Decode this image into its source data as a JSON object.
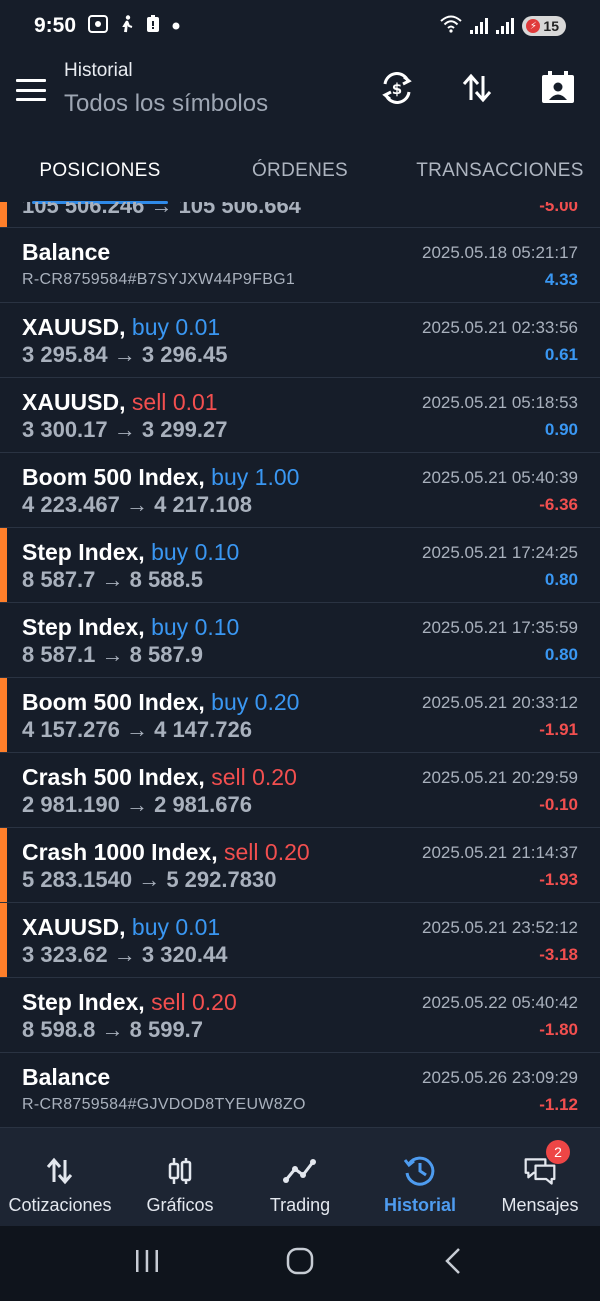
{
  "status_bar": {
    "time": "9:50",
    "battery": "15"
  },
  "header": {
    "title": "Historial",
    "subtitle": "Todos los símbolos"
  },
  "tabs": [
    {
      "label": "POSICIONES",
      "active": true
    },
    {
      "label": "ÓRDENES",
      "active": false
    },
    {
      "label": "TRANSACCIONES",
      "active": false
    }
  ],
  "partial_row": {
    "prices": "105 506.246 → 105 506.664",
    "profit": "-5.00"
  },
  "rows": [
    {
      "symbol": "Balance",
      "side": "",
      "volume": "",
      "sub": "R-CR8759584#B7SYJXW44P9FBG1",
      "time": "2025.05.18 05:21:17",
      "profit": "4.33",
      "positive": true,
      "marker": false,
      "kind": "balance"
    },
    {
      "symbol": "XAUUSD,",
      "side": "buy",
      "volume": "0.01",
      "sub": "3 295.84 → 3 296.45",
      "time": "2025.05.21 02:33:56",
      "profit": "0.61",
      "positive": true,
      "marker": false,
      "kind": "trade"
    },
    {
      "symbol": "XAUUSD,",
      "side": "sell",
      "volume": "0.01",
      "sub": "3 300.17 → 3 299.27",
      "time": "2025.05.21 05:18:53",
      "profit": "0.90",
      "positive": true,
      "marker": false,
      "kind": "trade"
    },
    {
      "symbol": "Boom 500 Index,",
      "side": "buy",
      "volume": "1.00",
      "sub": "4 223.467 → 4 217.108",
      "time": "2025.05.21 05:40:39",
      "profit": "-6.36",
      "positive": false,
      "marker": false,
      "kind": "trade"
    },
    {
      "symbol": "Step Index,",
      "side": "buy",
      "volume": "0.10",
      "sub": "8 587.7 → 8 588.5",
      "time": "2025.05.21 17:24:25",
      "profit": "0.80",
      "positive": true,
      "marker": true,
      "kind": "trade"
    },
    {
      "symbol": "Step Index,",
      "side": "buy",
      "volume": "0.10",
      "sub": "8 587.1 → 8 587.9",
      "time": "2025.05.21 17:35:59",
      "profit": "0.80",
      "positive": true,
      "marker": false,
      "kind": "trade"
    },
    {
      "symbol": "Boom 500 Index,",
      "side": "buy",
      "volume": "0.20",
      "sub": "4 157.276 → 4 147.726",
      "time": "2025.05.21 20:33:12",
      "profit": "-1.91",
      "positive": false,
      "marker": true,
      "kind": "trade"
    },
    {
      "symbol": "Crash 500 Index,",
      "side": "sell",
      "volume": "0.20",
      "sub": "2 981.190 → 2 981.676",
      "time": "2025.05.21 20:29:59",
      "profit": "-0.10",
      "positive": false,
      "marker": false,
      "kind": "trade"
    },
    {
      "symbol": "Crash 1000 Index,",
      "side": "sell",
      "volume": "0.20",
      "sub": "5 283.1540 → 5 292.7830",
      "time": "2025.05.21 21:14:37",
      "profit": "-1.93",
      "positive": false,
      "marker": true,
      "kind": "trade"
    },
    {
      "symbol": "XAUUSD,",
      "side": "buy",
      "volume": "0.01",
      "sub": "3 323.62 → 3 320.44",
      "time": "2025.05.21 23:52:12",
      "profit": "-3.18",
      "positive": false,
      "marker": true,
      "kind": "trade"
    },
    {
      "symbol": "Step Index,",
      "side": "sell",
      "volume": "0.20",
      "sub": "8 598.8 → 8 599.7",
      "time": "2025.05.22 05:40:42",
      "profit": "-1.80",
      "positive": false,
      "marker": false,
      "kind": "trade"
    },
    {
      "symbol": "Balance",
      "side": "",
      "volume": "",
      "sub": "R-CR8759584#GJVDOD8TYEUW8ZO",
      "time": "2025.05.26 23:09:29",
      "profit": "-1.12",
      "positive": false,
      "marker": false,
      "kind": "balance"
    }
  ],
  "bottom_nav": [
    {
      "label": "Cotizaciones",
      "icon": "quotes-icon",
      "active": false
    },
    {
      "label": "Gráficos",
      "icon": "charts-icon",
      "active": false
    },
    {
      "label": "Trading",
      "icon": "trading-icon",
      "active": false
    },
    {
      "label": "Historial",
      "icon": "history-icon",
      "active": true
    },
    {
      "label": "Mensajes",
      "icon": "messages-icon",
      "active": false,
      "badge": "2"
    }
  ],
  "colors": {
    "background": "#161d29",
    "buy": "#3a97f2",
    "sell": "#f24f4f",
    "marker": "#ff7f2a",
    "active_nav": "#4e9cf0"
  }
}
